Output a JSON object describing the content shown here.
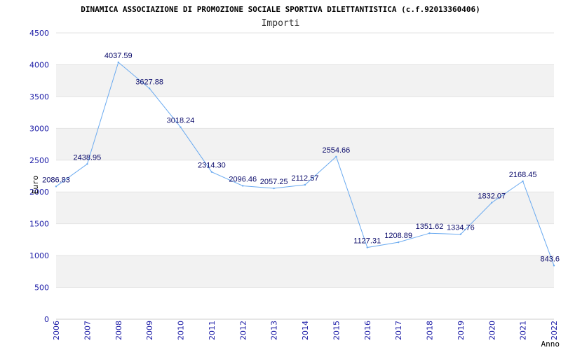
{
  "chart_data": {
    "type": "line",
    "title": "DINAMICA ASSOCIAZIONE DI PROMOZIONE SOCIALE SPORTIVA DILETTANTISTICA (c.f.92013360406)",
    "subtitle": "Importi",
    "xlabel": "Anno",
    "ylabel": "Euro",
    "ylim": [
      0,
      4500
    ],
    "yticks": [
      "0",
      "500",
      "1000",
      "1500",
      "2000",
      "2500",
      "3000",
      "3500",
      "4000",
      "4500"
    ],
    "categories": [
      "2006",
      "2007",
      "2008",
      "2009",
      "2010",
      "2011",
      "2012",
      "2013",
      "2014",
      "2015",
      "2016",
      "2017",
      "2018",
      "2019",
      "2020",
      "2021",
      "2022"
    ],
    "series": [
      {
        "values": [
          2086.83,
          2438.95,
          4037.59,
          3627.88,
          3018.24,
          2314.3,
          2096.46,
          2057.25,
          2112.57,
          2554.66,
          1127.31,
          1208.89,
          1351.62,
          1334.76,
          1832.07,
          2168.45,
          843.6
        ],
        "labels": [
          "2086.83",
          "2438.95",
          "4037.59",
          "3627.88",
          "3018.24",
          "2314.30",
          "2096.46",
          "2057.25",
          "2112.57",
          "2554.66",
          "1127.31",
          "1208.89",
          "1351.62",
          "1334.76",
          "1832.07",
          "2168.45",
          "843.6"
        ]
      }
    ],
    "grid": true,
    "legend": "none",
    "colors": {
      "line": "#6aaaf0",
      "band": "#f2f2f2",
      "tick_text": "#1a1aa6",
      "data_label": "#0b0b6b"
    }
  }
}
